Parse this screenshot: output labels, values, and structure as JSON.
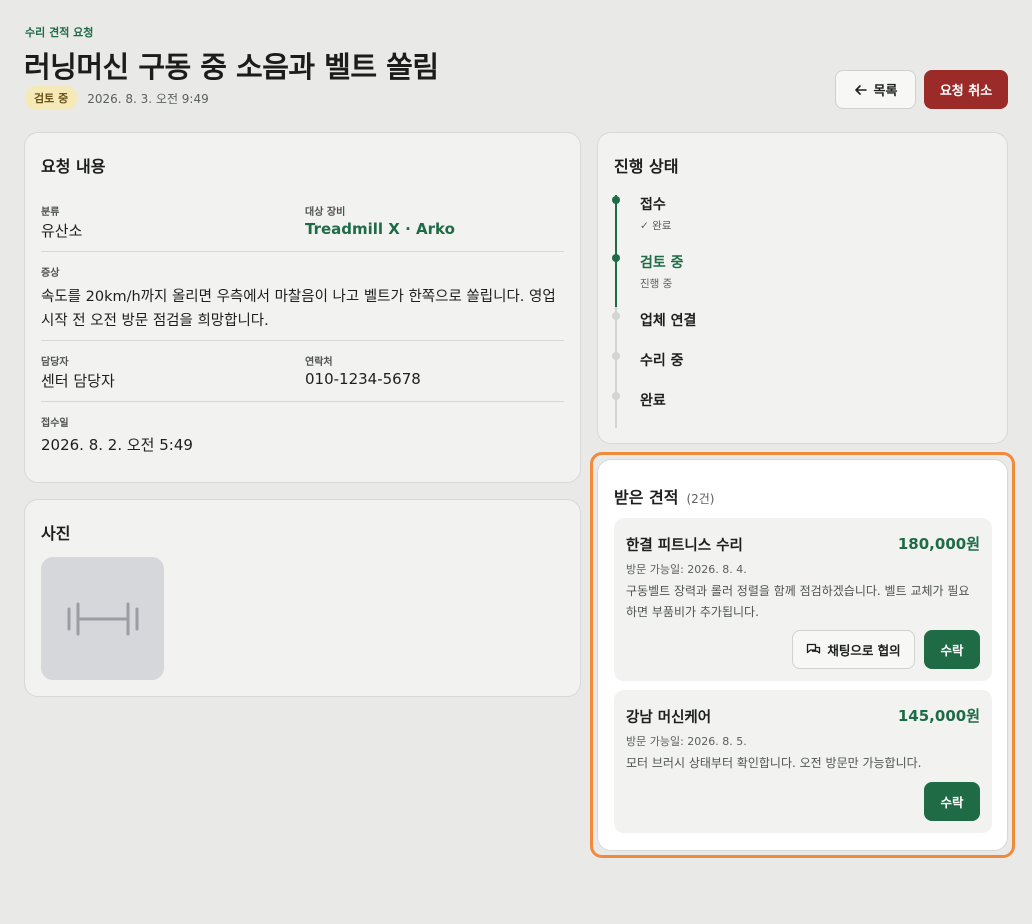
{
  "header": {
    "eyebrow": "수리 견적 요청",
    "title": "러닝머신 구동 중 소음과 벨트 쏠림",
    "status_badge": "검토 중",
    "created_at": "2026. 8. 3. 오전 9:49",
    "back_label": "목록",
    "cancel_label": "요청 취소"
  },
  "request": {
    "title": "요청 내용",
    "category_label": "분류",
    "category_value": "유산소",
    "equipment_label": "대상 장비",
    "equipment_value": "Treadmill X · Arko",
    "symptom_label": "증상",
    "symptom_value": "속도를 20km/h까지 올리면 우측에서 마찰음이 나고 벨트가 한쪽으로 쏠립니다. 영업 시작 전 오전 방문 점검을 희망합니다.",
    "manager_label": "담당자",
    "manager_value": "센터 담당자",
    "contact_label": "연락처",
    "contact_value": "010-1234-5678",
    "received_label": "접수일",
    "received_value": "2026. 8. 2. 오전 5:49"
  },
  "photos": {
    "title": "사진",
    "thumb_icon": "dumbbell-icon"
  },
  "progress": {
    "title": "진행 상태",
    "steps": [
      {
        "label": "접수",
        "sub": "✓ 완료",
        "state": "done"
      },
      {
        "label": "검토 중",
        "sub": "진행 중",
        "state": "active"
      },
      {
        "label": "업체 연결",
        "sub": "",
        "state": "todo"
      },
      {
        "label": "수리 중",
        "sub": "",
        "state": "todo"
      },
      {
        "label": "완료",
        "sub": "",
        "state": "todo"
      }
    ]
  },
  "quotes": {
    "title": "받은 견적",
    "count": "(2건)",
    "items": [
      {
        "vendor": "한결 피트니스 수리",
        "price": "180,000원",
        "visit_date": "방문 가능일: 2026. 8. 4.",
        "desc": "구동벨트 장력과 롤러 정렬을 함께 점검하겠습니다. 벨트 교체가 필요하면 부품비가 추가됩니다.",
        "chat_label": "채팅으로 협의",
        "accept_label": "수락"
      },
      {
        "vendor": "강남 머신케어",
        "price": "145,000원",
        "visit_date": "방문 가능일: 2026. 8. 5.",
        "desc": "모터 브러시 상태부터 확인합니다. 오전 방문만 가능합니다.",
        "accept_label": "수락"
      }
    ]
  },
  "colors": {
    "accent": "#1e6b46",
    "danger": "#9b2b28",
    "highlight": "#f18a3a",
    "badge_bg": "#f6e9b8"
  }
}
